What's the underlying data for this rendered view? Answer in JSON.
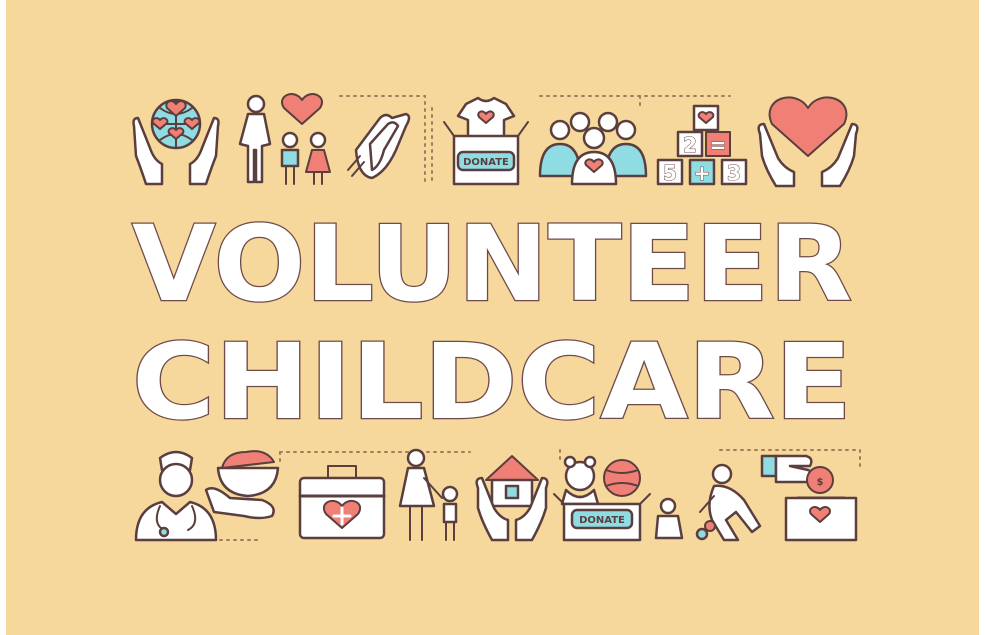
{
  "colors": {
    "background": "#f6d89c",
    "heart": "#f07f76",
    "accent": "#8fdce3",
    "outline": "#5b3e3e",
    "letters": "#ffffff"
  },
  "title": {
    "line1": "VOLUNTEER",
    "line2": "CHILDCARE"
  },
  "badges": {
    "donate_top": "DONATE",
    "donate_bottom": "DONATE"
  },
  "blocks": [
    "2",
    "=",
    "5",
    "+",
    "3"
  ],
  "coin": "$",
  "icons": {
    "top": [
      "globe-in-hands-icon",
      "family-icon",
      "helping-hands-icon",
      "donation-box-icon",
      "community-icon",
      "toy-blocks-icon",
      "heart-in-hands-icon"
    ],
    "bottom": [
      "nurse-icon",
      "food-bowl-icon",
      "first-aid-kit-icon",
      "parent-child-icon",
      "home-in-hands-icon",
      "toy-donation-icon",
      "childcare-play-icon",
      "money-donation-icon"
    ]
  }
}
